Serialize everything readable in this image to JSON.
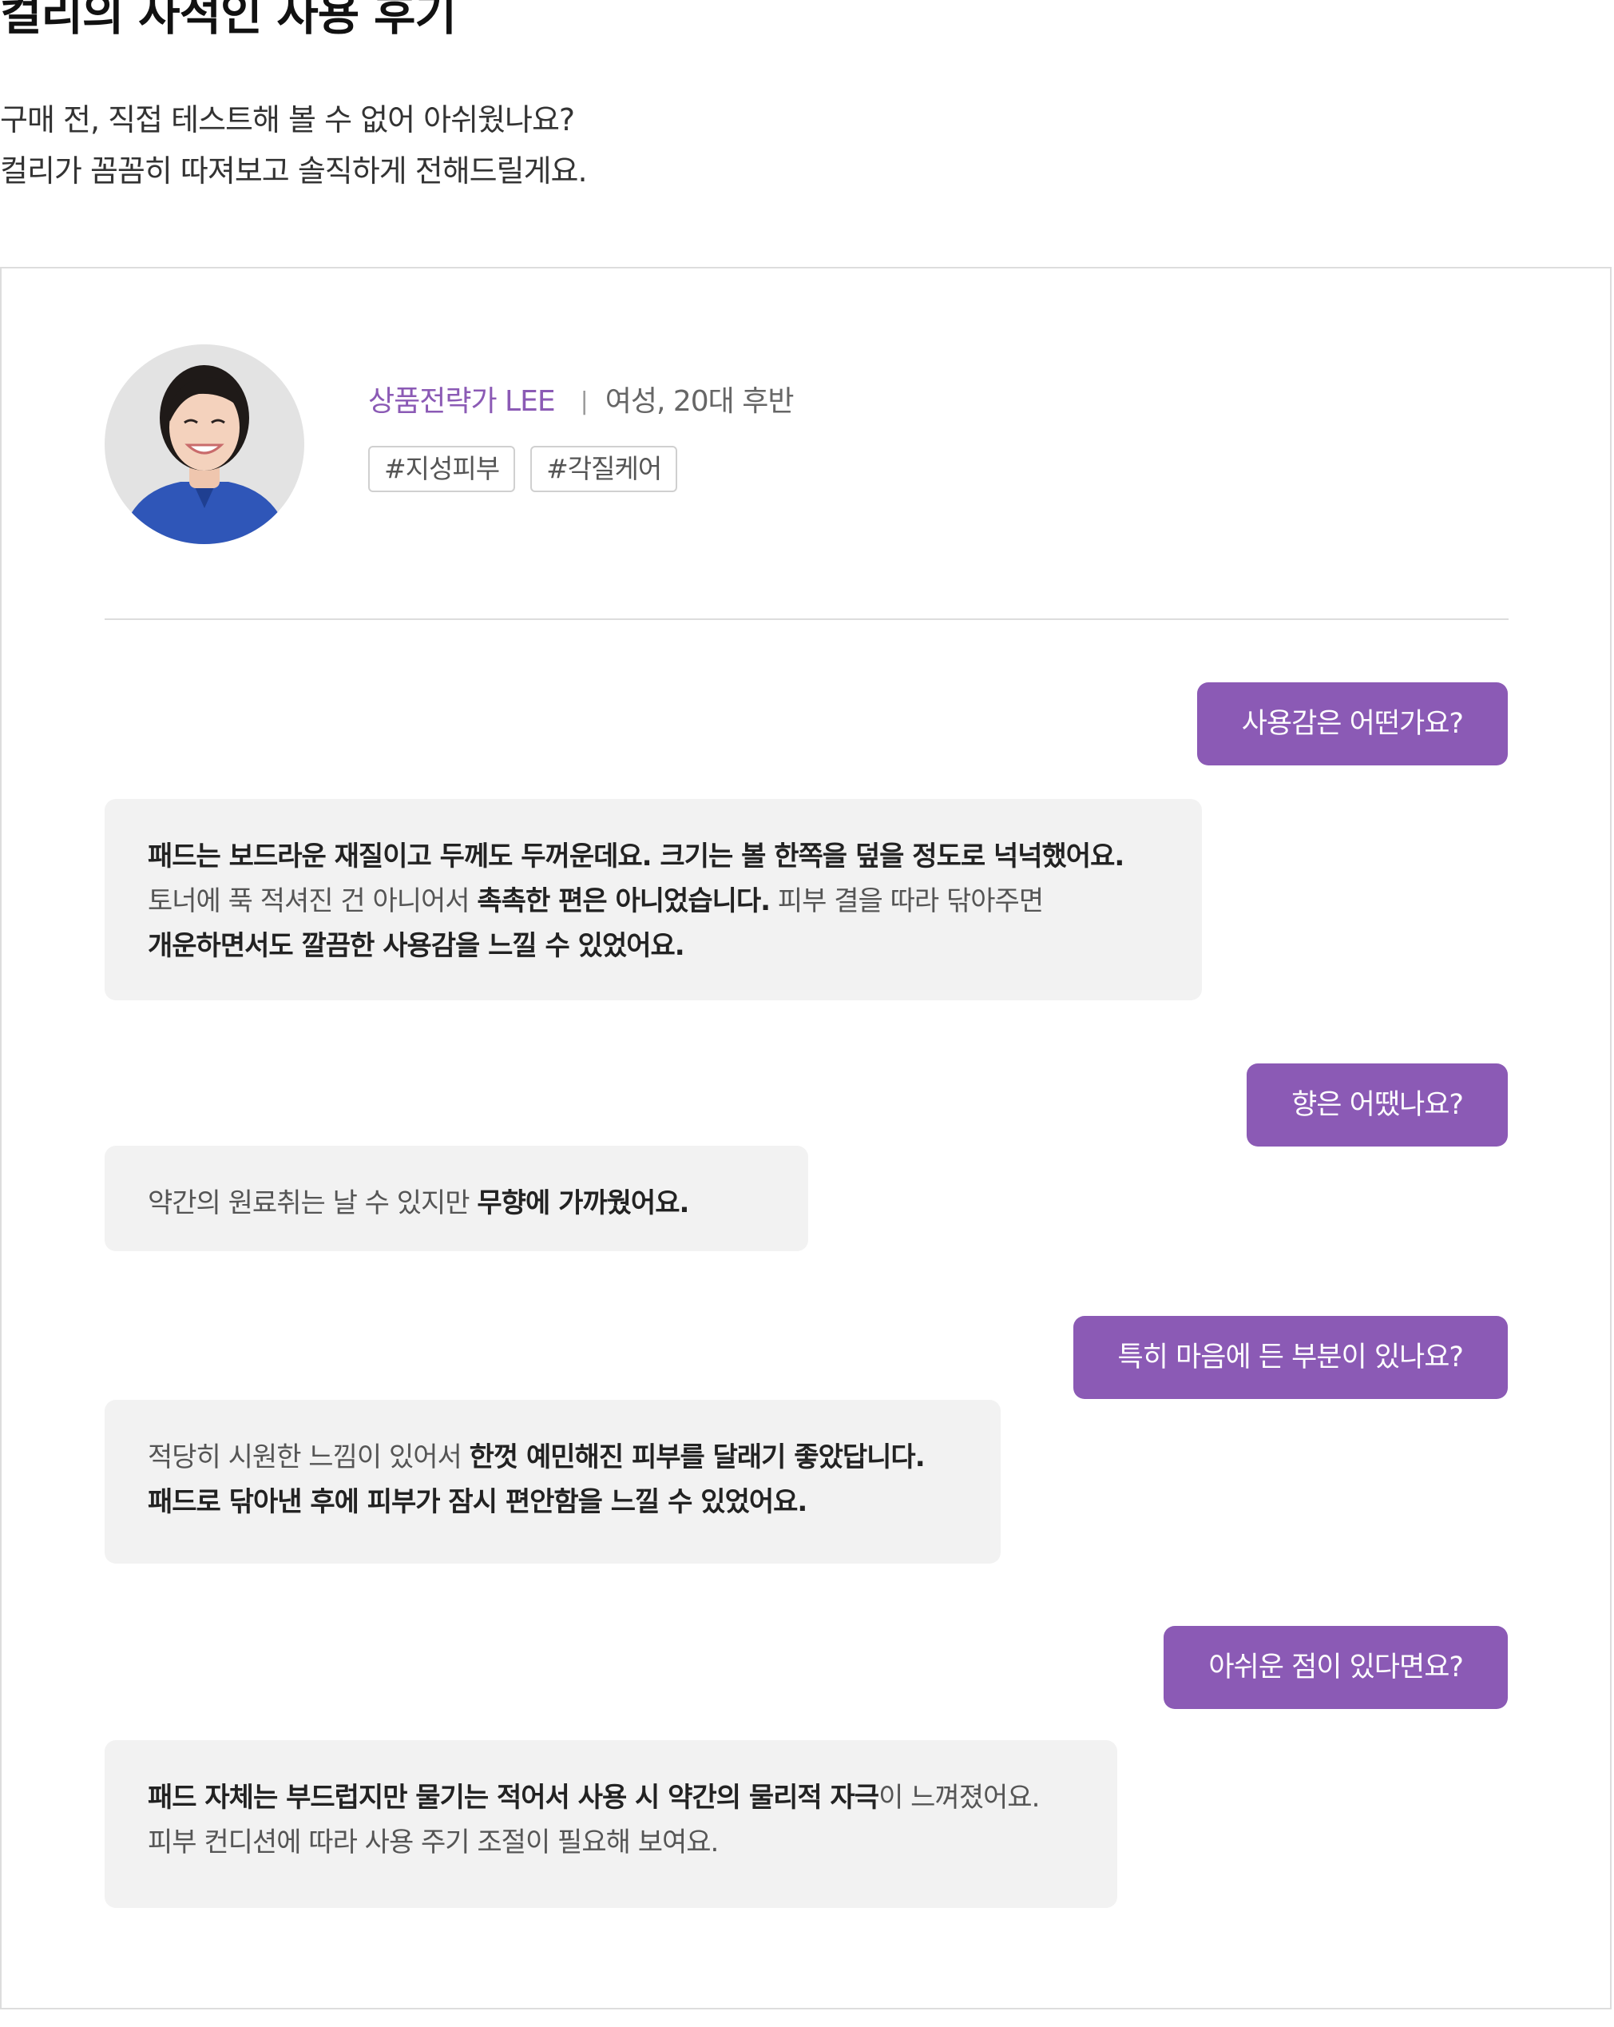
{
  "page": {
    "title": "컬리의 사적인 사용 후기",
    "intro_lines": [
      "구매 전, 직접 테스트해 볼 수 없어 아쉬웠나요?",
      "컬리가 꼼꼼히 따져보고 솔직하게 전해드릴게요."
    ]
  },
  "reviewer": {
    "role": "상품전략가 LEE",
    "separator": "|",
    "demographic": "여성, 20대 후반",
    "tags": [
      "#지성피부",
      "#각질케어"
    ]
  },
  "colors": {
    "accent": "#8b5ab5",
    "answer_bg": "#f2f2f2",
    "border": "#dddddd"
  },
  "qa": [
    {
      "question": "사용감은 어떤가요?",
      "answer_lines": [
        [
          {
            "text": "패드는 보드라운 재질이고 두께도 두꺼운데요. 크기는 볼 한쪽을 덮을 정도로 넉넉했어요.",
            "bold": true
          }
        ],
        [
          {
            "text": "토너에 푹 적셔진 건 아니어서 ",
            "bold": false
          },
          {
            "text": "촉촉한 편은 아니었습니다.",
            "bold": true
          },
          {
            "text": " 피부 결을 따라 닦아주면",
            "bold": false
          }
        ],
        [
          {
            "text": "개운하면서도 깔끔한 사용감을 느낄 수 있었어요.",
            "bold": true
          }
        ]
      ]
    },
    {
      "question": "향은 어땠나요?",
      "answer_lines": [
        [
          {
            "text": "약간의 원료취는 날 수 있지만 ",
            "bold": false
          },
          {
            "text": "무향에 가까웠어요.",
            "bold": true
          }
        ]
      ]
    },
    {
      "question": "특히 마음에 든 부분이 있나요?",
      "answer_lines": [
        [
          {
            "text": "적당히 시원한 느낌이 있어서 ",
            "bold": false
          },
          {
            "text": "한껏 예민해진 피부를 달래기 좋았답니다.",
            "bold": true
          }
        ],
        [
          {
            "text": "패드로 닦아낸 후에 피부가 잠시 편안함을 느낄 수 있었어요.",
            "bold": true
          }
        ]
      ]
    },
    {
      "question": "아쉬운 점이 있다면요?",
      "answer_lines": [
        [
          {
            "text": "패드 자체는 부드럽지만 물기는 적어서 사용 시 약간의 물리적 자극",
            "bold": true
          },
          {
            "text": "이 느껴졌어요.",
            "bold": false
          }
        ],
        [
          {
            "text": "피부 컨디션에 따라 사용 주기 조절이 필요해 보여요.",
            "bold": false
          }
        ]
      ]
    }
  ]
}
